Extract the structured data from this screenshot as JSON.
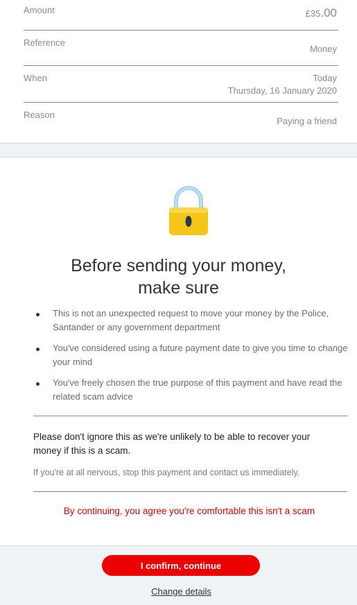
{
  "summary": {
    "amount_label": "Amount",
    "amount_currency_whole": "£35",
    "amount_pence": ".00",
    "reference_label": "Reference",
    "reference_value": "Money",
    "when_label": "When",
    "when_value": "Today",
    "when_date": "Thursday, 16 January 2020",
    "reason_label": "Reason",
    "reason_value": "Paying a friend"
  },
  "warning": {
    "lock_icon": "padlock-icon",
    "heading_line1": "Before sending your money,",
    "heading_line2": "make sure",
    "bullets": [
      "This is not an unexpected request to move your money by the Police, Santander or any government department",
      "You've considered using a future payment date to give you time to change your mind",
      "You've freely chosen the true purpose of this payment and have read the related scam advice"
    ],
    "notice": "Please don't ignore this as we're unlikely to be able to recover your money if this is a scam.",
    "nervous_text": "If you're at all nervous, stop this payment and contact us immediately.",
    "agree_text": "By continuing, you agree you're comfortable this isn't a scam"
  },
  "actions": {
    "confirm_label": "I confirm, continue",
    "change_label": "Change details"
  },
  "colors": {
    "brand_red": "#ec0000",
    "warning_red": "#e00000",
    "lock_yellow": "#f5c518",
    "lock_shackle": "#9fd0ef"
  }
}
